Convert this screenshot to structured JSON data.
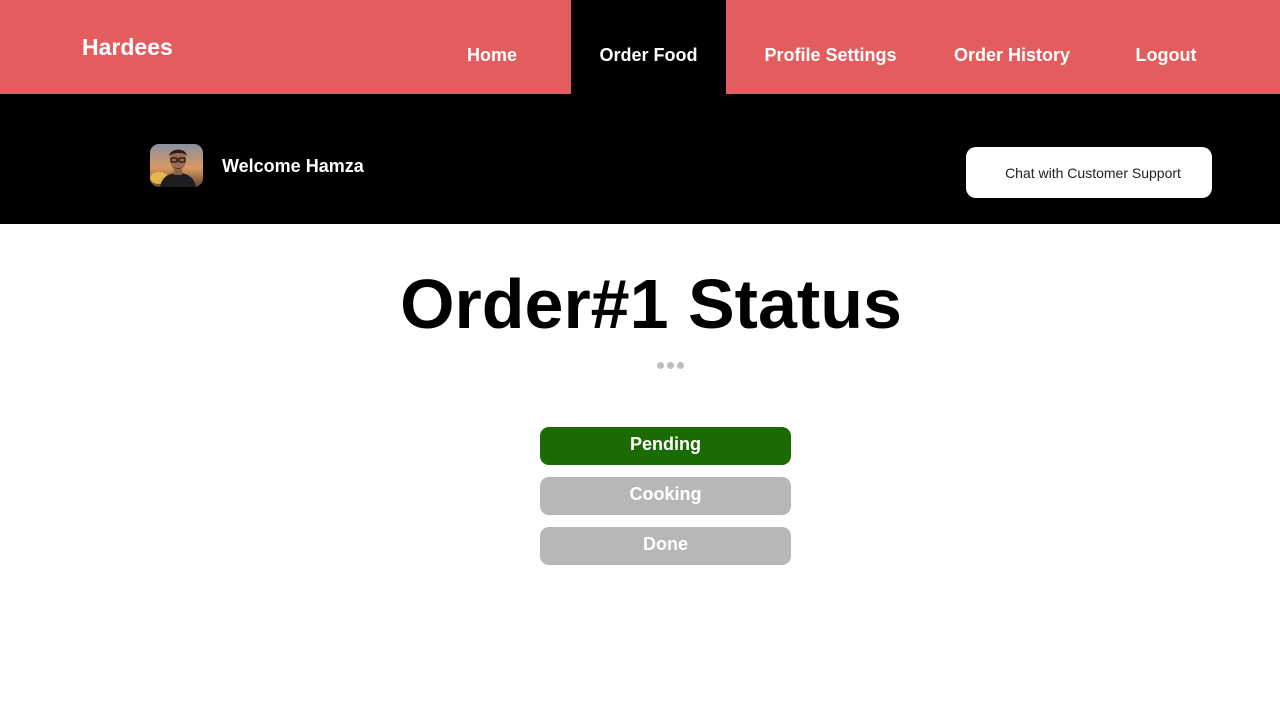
{
  "header": {
    "brand": "Hardees",
    "nav": [
      {
        "label": "Home",
        "active": false
      },
      {
        "label": "Order Food",
        "active": true
      },
      {
        "label": "Profile Settings",
        "active": false
      },
      {
        "label": "Order History",
        "active": false
      },
      {
        "label": "Logout",
        "active": false
      }
    ],
    "bg_color": "#e35d5f",
    "active_color": "#000000"
  },
  "welcome": {
    "text": "Welcome Hamza",
    "avatar_icon": "user-photo-avatar",
    "support_label": "Chat with Customer Support"
  },
  "main": {
    "title": "Order#1 Status",
    "separator_icon": "ellipsis-dots-icon",
    "statuses": [
      {
        "label": "Pending",
        "active": true,
        "color": "#1b6a03"
      },
      {
        "label": "Cooking",
        "active": false,
        "color": "#b7b7b7"
      },
      {
        "label": "Done",
        "active": false,
        "color": "#b7b7b7"
      }
    ]
  }
}
